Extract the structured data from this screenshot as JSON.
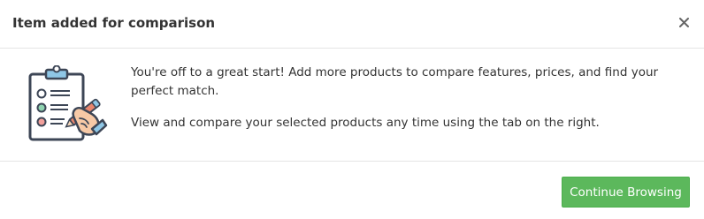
{
  "modal": {
    "title": "Item added for comparison",
    "close_icon": "close-icon",
    "illustration_icon": "clipboard-checklist-icon",
    "message_1": "You're off to a great start! Add more products to compare features, prices, and find your perfect match.",
    "message_2": "View and compare your selected products any time using the tab on the right.",
    "continue_label": "Continue Browsing"
  },
  "colors": {
    "primary_button": "#5cb85c",
    "divider": "#e5e5e5",
    "text": "#333333"
  }
}
